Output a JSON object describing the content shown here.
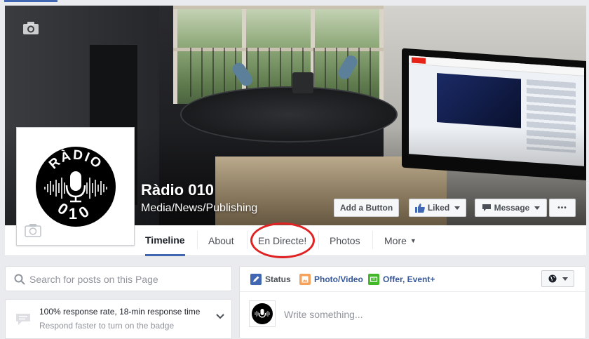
{
  "page": {
    "name": "Ràdio 010",
    "category": "Media/News/Publishing"
  },
  "logo": {
    "text_top": "RÀDIO",
    "text_bottom": "010"
  },
  "cover_buttons": {
    "add_button": "Add a Button",
    "liked": "Liked",
    "message": "Message",
    "more": "•••"
  },
  "tabs": [
    {
      "label": "Timeline",
      "active": true
    },
    {
      "label": "About",
      "active": false
    },
    {
      "label": "En Directe!",
      "active": false,
      "highlighted": true
    },
    {
      "label": "Photos",
      "active": false
    },
    {
      "label": "More",
      "active": false
    }
  ],
  "search": {
    "placeholder": "Search for posts on this Page"
  },
  "response": {
    "headline": "100% response rate, 18-min response time",
    "subtext": "Respond faster to turn on the badge"
  },
  "composer": {
    "tabs": [
      {
        "label": "Status"
      },
      {
        "label": "Photo/Video"
      },
      {
        "label": "Offer, Event+"
      }
    ],
    "placeholder": "Write something..."
  },
  "colors": {
    "facebook_blue": "#4267b2",
    "link_blue": "#365899",
    "highlight_circle": "#e02222",
    "background": "#e9ebee"
  },
  "icons": [
    "camera-icon",
    "thumbs-up-icon",
    "message-bubble-icon",
    "search-icon",
    "speech-bubble-icon",
    "chevron-down-icon",
    "pencil-icon",
    "photo-icon",
    "offer-icon",
    "globe-icon"
  ]
}
